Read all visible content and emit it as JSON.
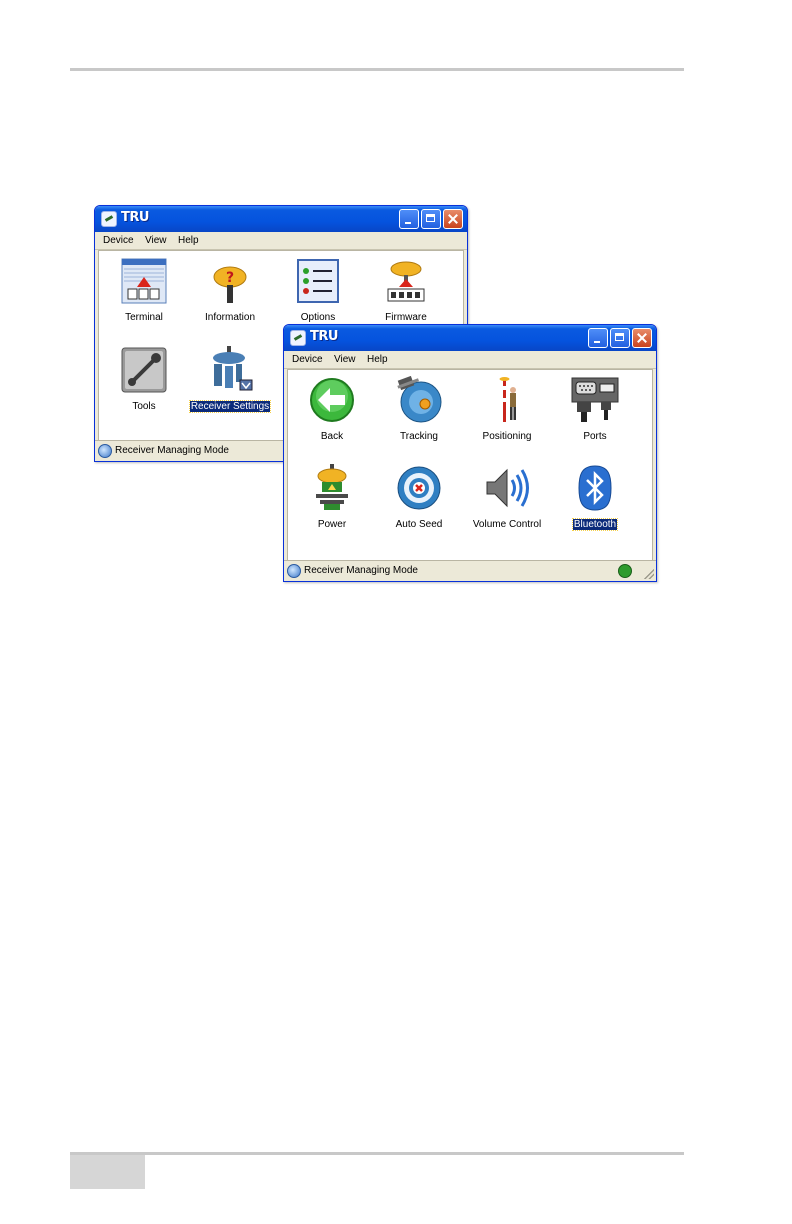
{
  "window_back": {
    "title": "TRU",
    "menu": [
      "Device",
      "View",
      "Help"
    ],
    "items": [
      {
        "label": "Terminal",
        "icon": "terminal-icon"
      },
      {
        "label": "Information",
        "icon": "information-icon"
      },
      {
        "label": "Options",
        "icon": "options-icon"
      },
      {
        "label": "Firmware",
        "icon": "firmware-icon"
      },
      {
        "label": "Tools",
        "icon": "tools-icon"
      },
      {
        "label": "Receiver Settings",
        "icon": "receiver-settings-icon",
        "selected": true
      }
    ],
    "status": "Receiver Managing Mode"
  },
  "window_front": {
    "title": "TRU",
    "menu": [
      "Device",
      "View",
      "Help"
    ],
    "items": [
      {
        "label": "Back",
        "icon": "back-arrow-icon"
      },
      {
        "label": "Tracking",
        "icon": "tracking-icon"
      },
      {
        "label": "Positioning",
        "icon": "positioning-icon"
      },
      {
        "label": "Ports",
        "icon": "ports-icon"
      },
      {
        "label": "Power",
        "icon": "power-icon"
      },
      {
        "label": "Auto Seed",
        "icon": "auto-seed-icon"
      },
      {
        "label": "Volume Control",
        "icon": "speaker-icon"
      },
      {
        "label": "Bluetooth",
        "icon": "bluetooth-icon",
        "selected": true
      }
    ],
    "status": "Receiver Managing Mode"
  },
  "colors": {
    "titlebar": "#0553de",
    "selection": "#0b2a7a",
    "window_face": "#ece9d8"
  }
}
